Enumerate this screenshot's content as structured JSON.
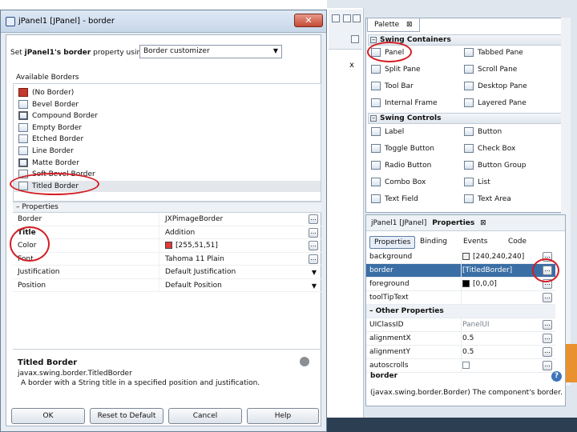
{
  "dialog": {
    "title": "jPanel1 [JPanel] - border",
    "close_glyph": "✕",
    "set_prefix": "Set ",
    "set_bold": "jPanel1's border",
    "set_suffix": " property using:",
    "customizer_value": "Border customizer",
    "available_label": "Available Borders",
    "borders": [
      "(No Border)",
      "Bevel Border",
      "Compound Border",
      "Empty Border",
      "Etched Border",
      "Line Border",
      "Matte Border",
      "Soft Bevel Border",
      "Titled Border"
    ],
    "selected_border_index": 8,
    "properties_header": "Properties",
    "properties": [
      {
        "name": "Border",
        "value": "JXPimageBorder",
        "ellipsis": true,
        "bold": false
      },
      {
        "name": "Title",
        "value": "Addition",
        "ellipsis": true,
        "bold": true
      },
      {
        "name": "Color",
        "value": "[255,51,51]",
        "ellipsis": true,
        "bold": false,
        "swatch": "#e03a3a"
      },
      {
        "name": "Font",
        "value": "Tahoma 11 Plain",
        "ellipsis": true,
        "bold": false
      },
      {
        "name": "Justification",
        "value": "Default Justification",
        "dropdown": true,
        "bold": false
      },
      {
        "name": "Position",
        "value": "Default Position",
        "dropdown": true,
        "bold": false
      }
    ],
    "desc_title": "Titled Border",
    "desc_class": "javax.swing.border.TitledBorder",
    "desc_text": "A border with a String title in a specified position and justification.",
    "buttons": {
      "ok": "OK",
      "reset": "Reset to Default",
      "cancel": "Cancel",
      "help": "Help"
    }
  },
  "editor": {
    "x_mark": "x"
  },
  "palette": {
    "tab_label": "Palette",
    "tab_close": "⊠",
    "cat_containers": "Swing Containers",
    "containers": [
      [
        "Panel",
        "Tabbed Pane"
      ],
      [
        "Split Pane",
        "Scroll Pane"
      ],
      [
        "Tool Bar",
        "Desktop Pane"
      ],
      [
        "Internal Frame",
        "Layered Pane"
      ]
    ],
    "cat_controls": "Swing Controls",
    "controls": [
      [
        "Label",
        "Button"
      ],
      [
        "Toggle Button",
        "Check Box"
      ],
      [
        "Radio Button",
        "Button Group"
      ],
      [
        "Combo Box",
        "List"
      ],
      [
        "Text Field",
        "Text Area"
      ]
    ],
    "label_icon_text": "label",
    "ok_icon_text": "OK",
    "tx_icon_text": "tx"
  },
  "properties_panel": {
    "title_prefix": "jPanel1 [JPanel]",
    "title_bold": "Properties",
    "close": "⊠",
    "tabs": [
      "Properties",
      "Binding",
      "Events",
      "Code"
    ],
    "rows": [
      {
        "name": "background",
        "value": "[240,240,240]",
        "swatch": "#f0f0f0"
      },
      {
        "name": "border",
        "value": "[TitledBorder]",
        "selected": true
      },
      {
        "name": "foreground",
        "value": "[0,0,0]",
        "swatch": "#000000"
      },
      {
        "name": "toolTipText",
        "value": ""
      },
      {
        "category": "Other Properties"
      },
      {
        "name": "UIClassID",
        "value": "PanelUI",
        "gray": true
      },
      {
        "name": "alignmentX",
        "value": "0.5"
      },
      {
        "name": "alignmentY",
        "value": "0.5"
      },
      {
        "name": "autoscrolls",
        "value": "",
        "checkbox": true
      }
    ],
    "desc_title": "border",
    "desc_text": "(javax.swing.border.Border) The component's border.",
    "help_glyph": "?"
  },
  "ellipsis_glyph": "...",
  "dropdown_glyph": "▼",
  "minus_glyph": "–",
  "colors": {
    "annotation_red": "#d41d24",
    "selection_blue": "#3a6ea5",
    "accent_orange": "#e8912e"
  }
}
